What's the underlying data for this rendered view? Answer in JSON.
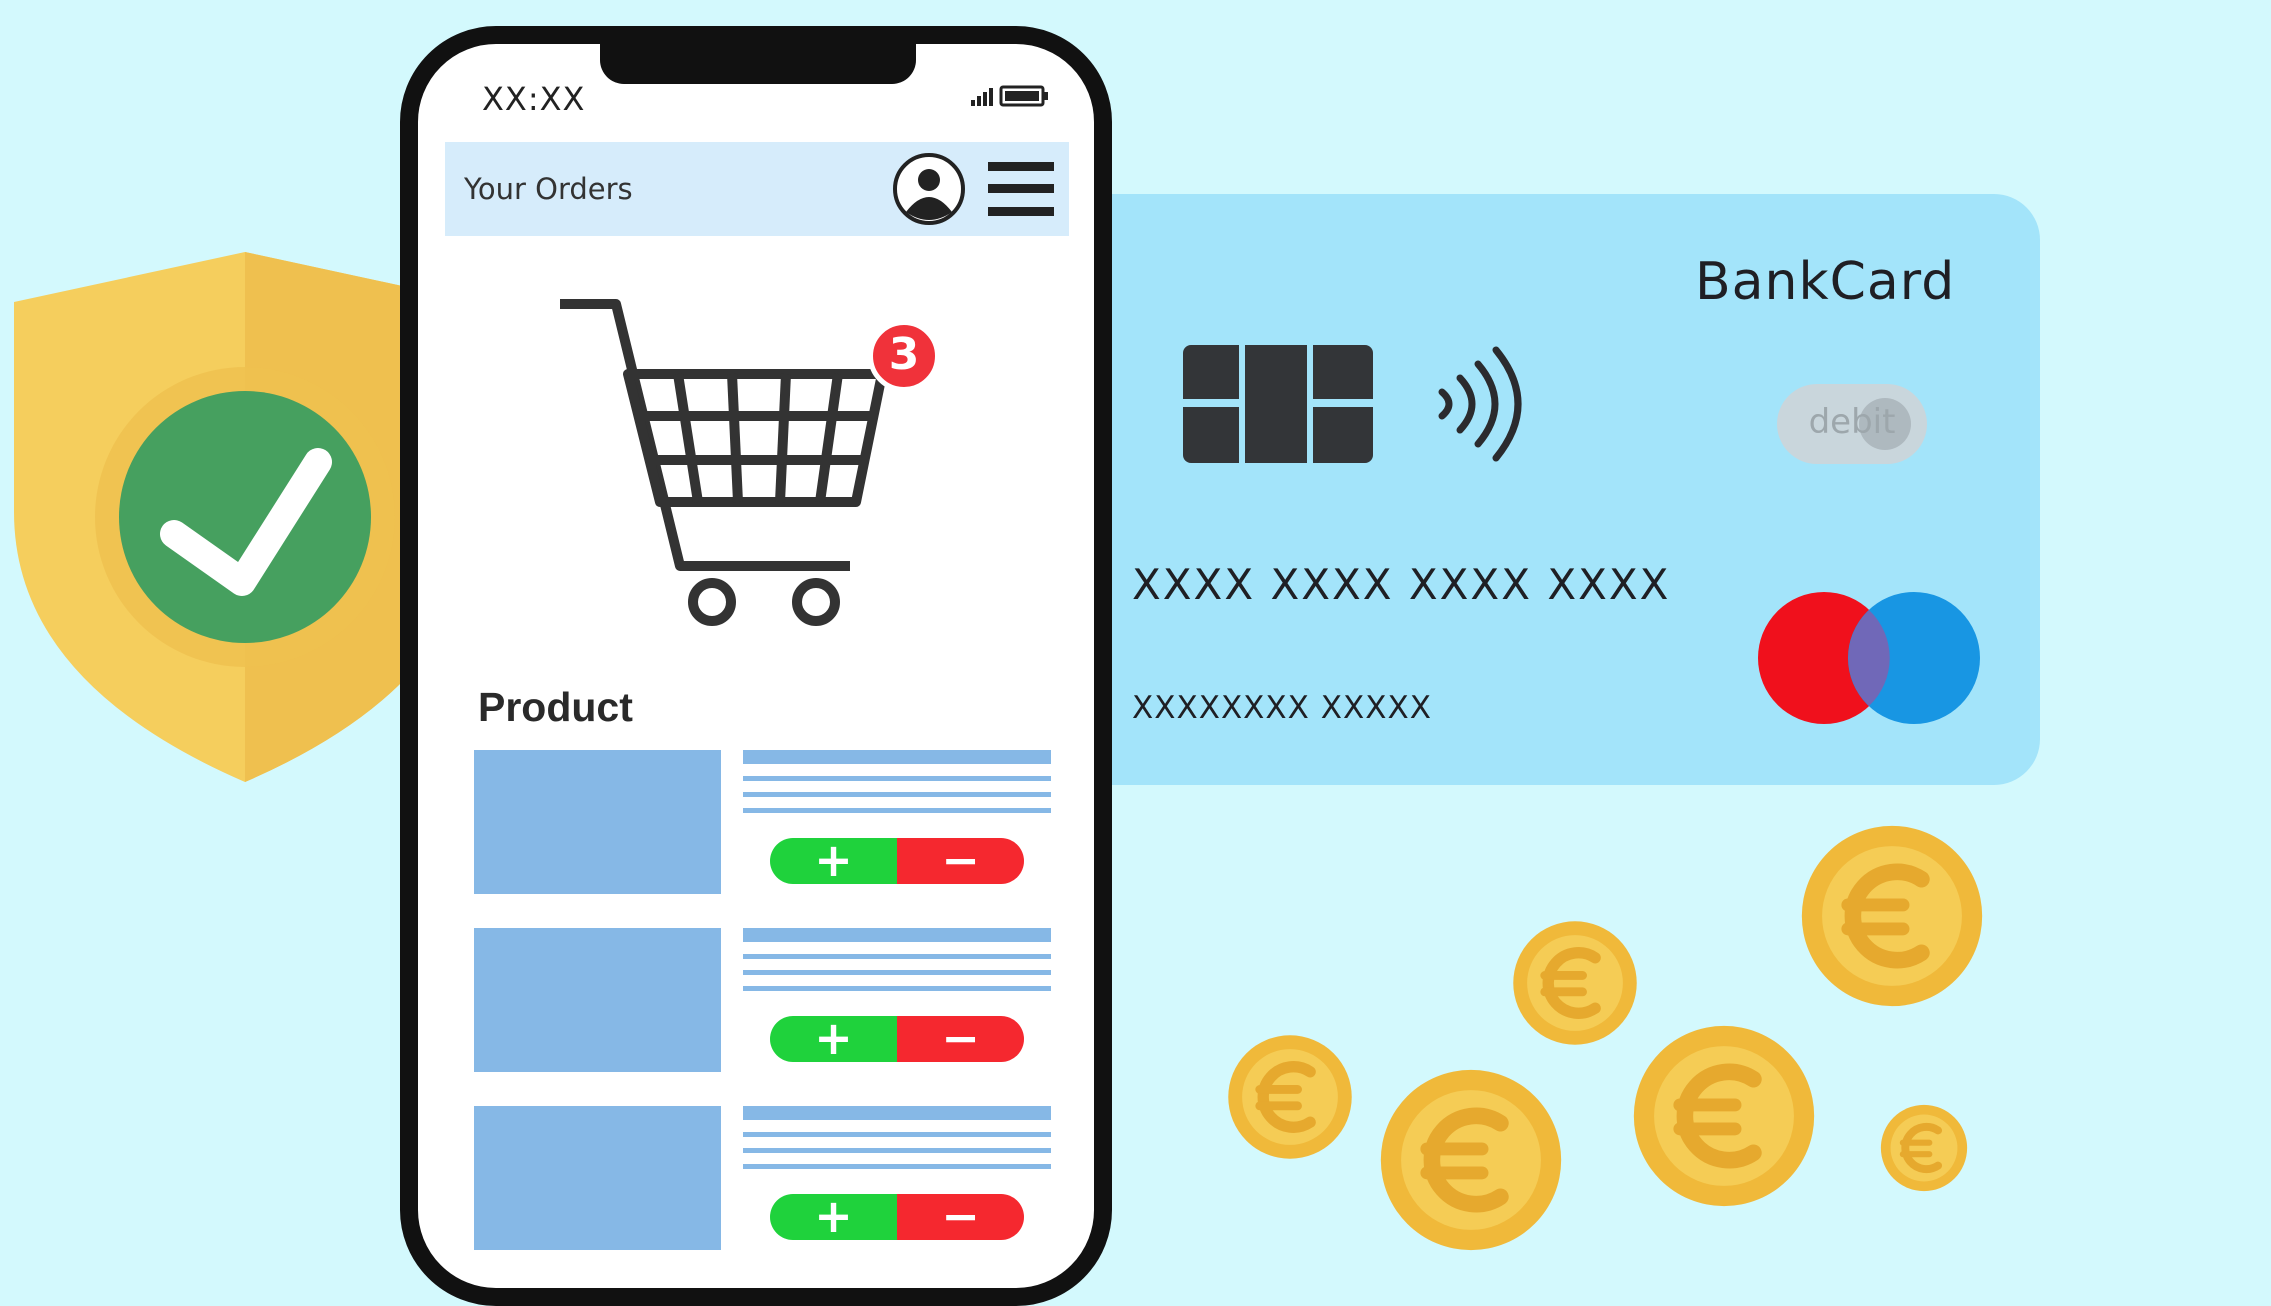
{
  "card": {
    "brand": "BankCard",
    "debit_label": "debit",
    "number": "XXXX XXXX XXXX XXXX",
    "holder": "XXXXXXXX XXXXX"
  },
  "phone": {
    "status_time": "XX:XX",
    "header_title": "Your Orders",
    "cart_badge": "3",
    "product_heading": "Product",
    "products": [
      {
        "plus": "+",
        "minus": "−"
      },
      {
        "plus": "+",
        "minus": "−"
      },
      {
        "plus": "+",
        "minus": "−"
      }
    ]
  },
  "icons": {
    "shield": "shield-check-icon",
    "cart": "shopping-cart-icon",
    "avatar": "user-avatar-icon",
    "menu": "hamburger-menu-icon",
    "chip": "card-chip-icon",
    "contactless": "contactless-icon",
    "mastercard": "mastercard-logo-icon",
    "coin": "euro-coin-icon"
  },
  "colors": {
    "background": "#d3f9fd",
    "card": "#a3e4fa",
    "shield": "#f5c95a",
    "check": "#45a05f",
    "plus": "#1fd23c",
    "minus": "#f5282f",
    "badge": "#f0323a",
    "coin": "#f0b93a"
  }
}
